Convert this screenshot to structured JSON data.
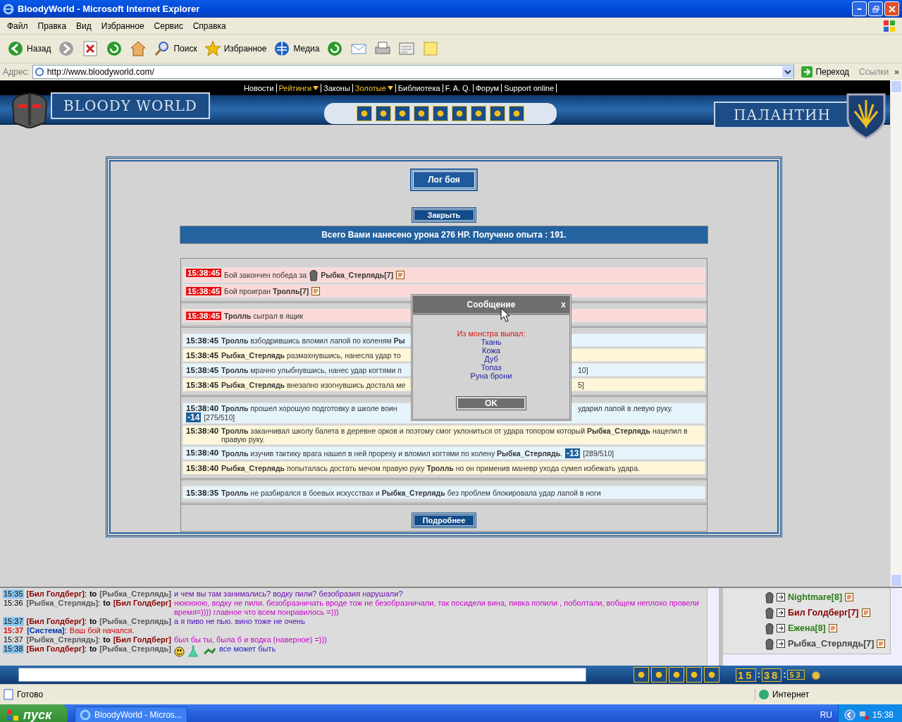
{
  "window": {
    "title": "BloodyWorld - Microsoft Internet Explorer"
  },
  "menu": [
    "Файл",
    "Правка",
    "Вид",
    "Избранное",
    "Сервис",
    "Справка"
  ],
  "toolbar": [
    {
      "kind": "back",
      "label": "Назад"
    },
    {
      "kind": "forward"
    },
    {
      "kind": "stop"
    },
    {
      "kind": "refresh"
    },
    {
      "kind": "home"
    },
    {
      "kind": "search",
      "label": "Поиск"
    },
    {
      "kind": "favorites",
      "label": "Избранное"
    },
    {
      "kind": "media",
      "label": "Медиа"
    },
    {
      "kind": "history"
    },
    {
      "kind": "mail"
    },
    {
      "kind": "print"
    },
    {
      "kind": "edit"
    },
    {
      "kind": "note"
    }
  ],
  "address": {
    "label": "Адрес:",
    "url": "http://www.bloodyworld.com/",
    "go": "Переход",
    "links": "Ссылки",
    "more": "»"
  },
  "site_nav": [
    {
      "label": "Новости",
      "dropdown": false
    },
    {
      "label": "Рейтинги",
      "dropdown": true
    },
    {
      "label": "Законы",
      "dropdown": false
    },
    {
      "label": "Золотые",
      "dropdown": true
    },
    {
      "label": "Библиотека",
      "dropdown": false
    },
    {
      "label": "F. A. Q.",
      "dropdown": false
    },
    {
      "label": "Форум",
      "dropdown": false
    },
    {
      "label": "Support online",
      "dropdown": false
    }
  ],
  "logo_left": "BLOODY WORLD",
  "logo_right": "ПАЛАНТИН",
  "battle_log": {
    "title": "Лог боя",
    "close": "Закрыть",
    "summary": "Всего Вами нанесено урона 276 HP. Получено опыта : 191.",
    "more": "Подробнее",
    "groups": [
      [
        {
          "time": "15:38:45",
          "kind": "alert",
          "parts": [
            {
              "kind": "text",
              "text": "Бой закончен победа за"
            },
            {
              "kind": "avatar"
            },
            {
              "kind": "text",
              "text": "**Рыбка_Стерлядь[7]**"
            },
            {
              "kind": "info"
            }
          ]
        },
        {
          "time": "15:38:45",
          "kind": "alert",
          "parts": [
            {
              "kind": "text",
              "text": "Бой проигран **Тролль[7]**"
            },
            {
              "kind": "info"
            }
          ]
        }
      ],
      [
        {
          "time": "15:38:45",
          "kind": "alert",
          "parts": [
            {
              "kind": "text",
              "text": "**Тролль** сыграл в ящик"
            }
          ]
        }
      ],
      [
        {
          "time": "15:38:45",
          "kind": "blue",
          "parts": [
            {
              "kind": "text",
              "text": "**Тролль** взбодрившись вломил лапой по коленям **Ры**"
            }
          ]
        },
        {
          "time": "15:38:45",
          "kind": "yellow",
          "parts": [
            {
              "kind": "text",
              "text": "**Рыбка_Стерлядь** размахнувшись, нанесла удар то"
            }
          ]
        },
        {
          "time": "15:38:45",
          "kind": "blue",
          "parts": [
            {
              "kind": "text",
              "text": "**Тролль** мрачно улыбнувшись, нанес удар когтями п"
            }
          ],
          "tail": [
            {
              "kind": "text",
              "text": "10]"
            }
          ]
        },
        {
          "time": "15:38:45",
          "kind": "yellow",
          "parts": [
            {
              "kind": "text",
              "text": "**Рыбка_Стерлядь** внезапно изогнувшись достала ме"
            }
          ],
          "tail": [
            {
              "kind": "text",
              "text": "5]"
            }
          ]
        }
      ],
      [
        {
          "time": "15:38:40",
          "kind": "blue",
          "parts": [
            {
              "kind": "text",
              "text": "**Тролль** прошел хорошую подготовку в школе воин"
            }
          ],
          "tail": [
            {
              "kind": "text",
              "text": "ударил лапой в левую руку."
            }
          ],
          "next_line": [
            {
              "kind": "damage",
              "text": "-14"
            },
            {
              "kind": "text",
              "text": "[275/510]"
            }
          ]
        },
        {
          "time": "15:38:40",
          "kind": "yellow",
          "parts": [
            {
              "kind": "text",
              "text": "**Тролль** заканчивал школу балета в деревне орков и поэтому смог уклониться от удара топором который **Рыбка_Стерлядь** нацелил в правую руку."
            }
          ]
        },
        {
          "time": "15:38:40",
          "kind": "blue",
          "parts": [
            {
              "kind": "text",
              "text": "**Тролль** изучив тактику врага нашел в ней прореху и вломил когтями по колену **Рыбка_Стерлядь**."
            },
            {
              "kind": "damage",
              "text": "-13"
            },
            {
              "kind": "text",
              "text": "[289/510]"
            }
          ]
        },
        {
          "time": "15:38:40",
          "kind": "yellow",
          "parts": [
            {
              "kind": "text",
              "text": "**Рыбка_Стерлядь** попыталась достать мечом правую руку **Тролль** но он применив маневр ухода сумел избежать удара."
            }
          ]
        }
      ],
      [
        {
          "time": "15:38:35",
          "kind": "blue",
          "parts": [
            {
              "kind": "text",
              "text": "**Тролль** не разбирался в боевых искусствах и **Рыбка_Стерлядь** без проблем блокировала удар лапой в ноги"
            }
          ]
        }
      ]
    ]
  },
  "dialog": {
    "title": "Сообщение",
    "close": "x",
    "heading": "Из монстра выпал:",
    "items": [
      "Ткань",
      "Кожа",
      "Дуб",
      "Топаз",
      "Руна брони"
    ],
    "ok": "OK"
  },
  "chat": [
    {
      "time": {
        "text": "15:35",
        "kind": "highlight"
      },
      "sender": {
        "text": "[Бил Голдберг]",
        "color": "#8b0000"
      },
      "sep": ":",
      "to": "to",
      "recipient": {
        "text": "[Рыбка_Стерлядь]",
        "color": "#555555"
      },
      "message": "и чем вы там занимались? водку пили? безобразия нарушали?",
      "color": "#6a0dad"
    },
    {
      "time": {
        "text": "15:36",
        "kind": "plain"
      },
      "sender": {
        "text": "[Рыбка_Стерлядь]",
        "color": "#555555"
      },
      "sep": ":",
      "to": "to",
      "recipient": {
        "text": "[Бил Голдберг]",
        "color": "#8b0000"
      },
      "message": "нююююю, водку не пили. безобразничать вроде тож не безобразничали, так посидели вина, пивка попили , поболтали, вобщем неплохо провели время=)))) главное что всем понравилось =)))",
      "color": "#cc00cc"
    },
    {
      "time": {
        "text": "15:37",
        "kind": "highlight"
      },
      "sender": {
        "text": "[Бил Голдберг]",
        "color": "#8b0000"
      },
      "sep": ":",
      "to": "to",
      "recipient": {
        "text": "[Рыбка_Стерлядь]",
        "color": "#555555"
      },
      "message": "а я пиво не пью. вино тоже не очень",
      "color": "#4b0bb4"
    },
    {
      "time": {
        "text": "15:37",
        "kind": "alert"
      },
      "sender": {
        "text": "[Система]",
        "color": "#0033aa"
      },
      "sep": ":",
      "message": "Ваш бой начался.",
      "color": "#cc0000"
    },
    {
      "time": {
        "text": "15:37",
        "kind": "plain"
      },
      "sender": {
        "text": "[Рыбка_Стерлядь]",
        "color": "#555555"
      },
      "sep": ":",
      "to": "to",
      "recipient": {
        "text": "[Бил Голдберг]",
        "color": "#8b0000"
      },
      "message": "был бы ты, была б и водка (наверное) =)))",
      "color": "#cc00cc"
    },
    {
      "time": {
        "text": "15:38",
        "kind": "highlight"
      },
      "sender": {
        "text": "[Бил Голдберг]",
        "color": "#8b0000"
      },
      "sep": ":",
      "to": "to",
      "recipient": {
        "text": "[Рыбка_Стерлядь]",
        "color": "#555555"
      },
      "emoticons": true,
      "message": "все может быть",
      "color": "#2222cc"
    }
  ],
  "online": [
    {
      "name": "Nightmare[8]",
      "color": "#2e7d18"
    },
    {
      "name": "Бил Голдберг[7]",
      "color": "#8b0000"
    },
    {
      "name": "Ежена[8]",
      "color": "#2e7d18"
    },
    {
      "name": "Рыбка_Стерлядь[7]",
      "color": "#444444"
    }
  ],
  "clock": [
    "15",
    ":",
    "38",
    ":",
    "53"
  ],
  "status": {
    "text": "Готово",
    "zone": "Интернет"
  },
  "taskbar": {
    "start": "пуск",
    "task": "BloodyWorld - Micros...",
    "lang": "RU",
    "time": "15:38"
  }
}
